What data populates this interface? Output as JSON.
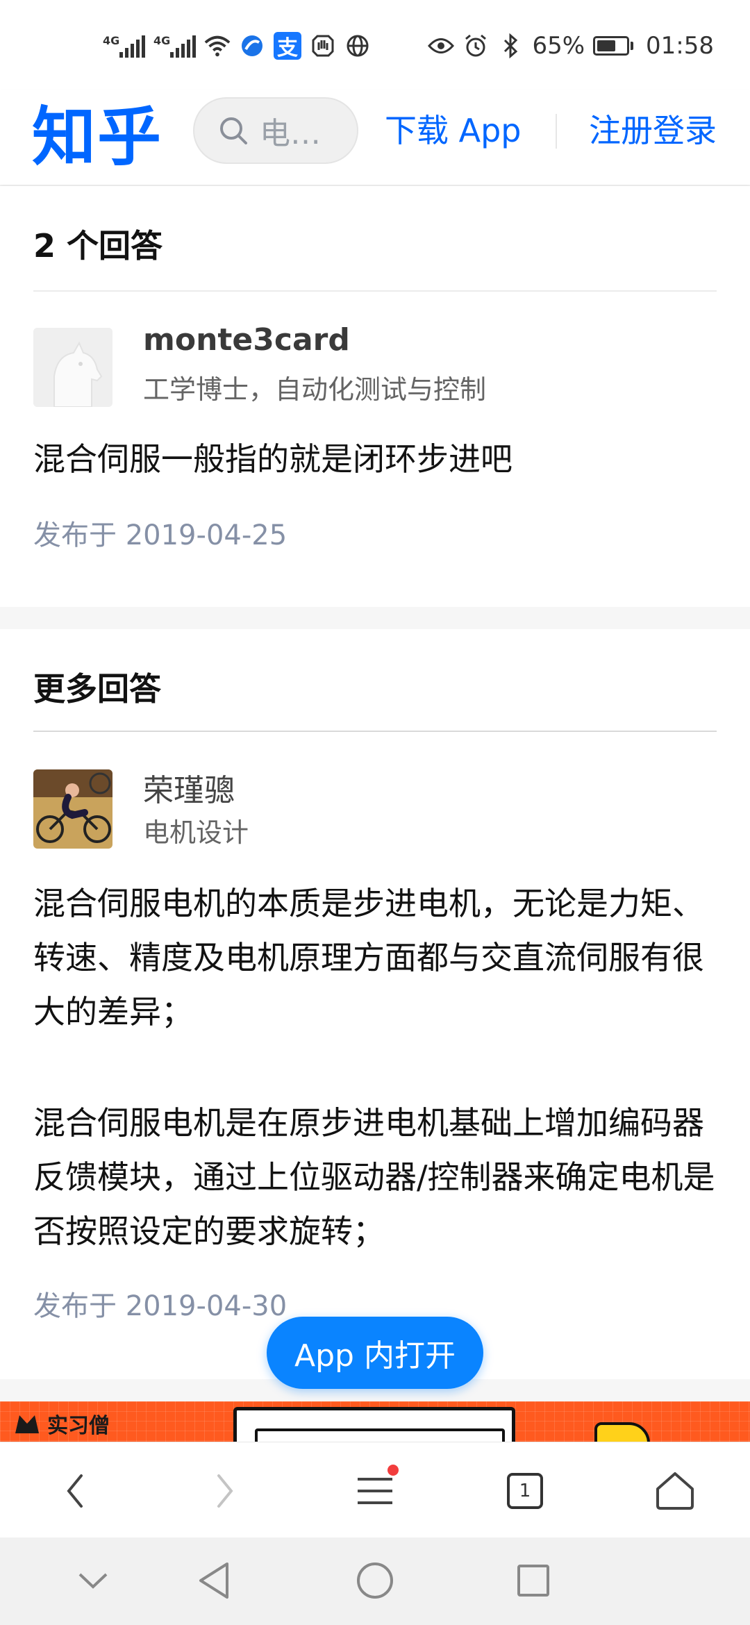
{
  "status_bar": {
    "signal1_label": "4G",
    "signal2_label": "4G",
    "alipay_glyph": "支",
    "battery_text": "65%",
    "battery_level": 0.65,
    "time": "01:58",
    "icons": [
      "signal-icon",
      "wifi-icon",
      "browser-app-icon",
      "alipay-icon",
      "hand-icon",
      "globe-icon",
      "eye-icon",
      "alarm-icon",
      "bluetooth-icon",
      "battery-icon"
    ]
  },
  "header": {
    "logo": "知乎",
    "search_placeholder": "电…",
    "download_label": "下载 App",
    "login_label": "注册登录"
  },
  "answers_section": {
    "title": "2 个回答",
    "answer": {
      "author": "monte3card",
      "bio": "工学博士，自动化测试与控制",
      "text": "混合伺服一般指的就是闭环步进吧",
      "date": "发布于 2019-04-25"
    }
  },
  "more_section": {
    "title": "更多回答",
    "answer": {
      "author": "荣瑾骢",
      "bio": "电机设计",
      "paragraph1": "混合伺服电机的本质是步进电机，无论是力矩、转速、精度及电机原理方面都与交直流伺服有很大的差异；",
      "paragraph2": "混合伺服电机是在原步进电机基础上增加编码器反馈模块，通过上位驱动器/控制器来确定电机是否按照设定的要求旋转；",
      "date": "发布于 2019-04-30"
    }
  },
  "open_app_label": "App 内打开",
  "ad": {
    "brand_text": "实习僧"
  },
  "browser_bar": {
    "tab_count": "1"
  },
  "colors": {
    "brand": "#0066ff",
    "open_app": "#0a84ff",
    "ad": "#ff5a1f",
    "date": "#8590a6"
  }
}
